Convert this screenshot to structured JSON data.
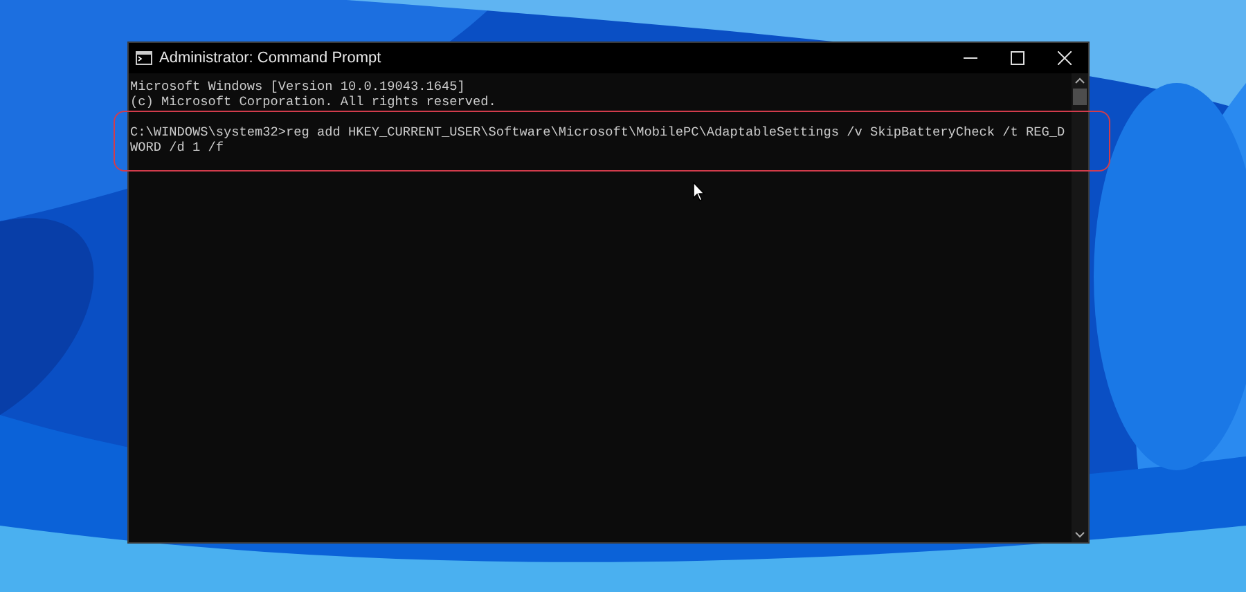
{
  "window": {
    "title": "Administrator: Command Prompt"
  },
  "console": {
    "header_lines": [
      "Microsoft Windows [Version 10.0.19043.1645]",
      "(c) Microsoft Corporation. All rights reserved."
    ],
    "command_lines": [
      "C:\\WINDOWS\\system32>reg add HKEY_CURRENT_USER\\Software\\Microsoft\\MobilePC\\AdaptableSettings /v SkipBatteryCheck /t REG_D",
      "WORD /d 1 /f"
    ]
  }
}
